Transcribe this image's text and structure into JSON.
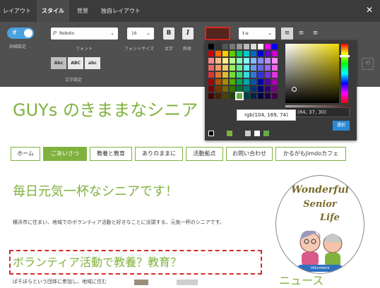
{
  "tabs": [
    "レイアウト",
    "スタイル",
    "背景",
    "独自レイアウト"
  ],
  "toolbar": {
    "toggle_label": "オ",
    "detail_label": "詳細設定",
    "font_value": "Roboto",
    "font_label": "フォント",
    "size_value": "16",
    "size_label": "フォントサイズ",
    "bold_label": "太字",
    "italic_label": "斜体",
    "bold_glyph": "B",
    "italic_glyph": "I",
    "case_buttons": [
      "Abc",
      "ABC",
      "abc"
    ],
    "case_label": "文字設定"
  },
  "picker": {
    "rgb_value": "(84, 37, 30)",
    "select_button": "選択",
    "tooltip": "rgb(104, 169, 74)"
  },
  "site": {
    "title": "GUYs のきままなシニア",
    "nav": [
      "ホーム",
      "ごあいさつ",
      "教養と教育",
      "ありのままに",
      "活動拠点",
      "お問い合わせ",
      "かるがもJimdoカフェ"
    ],
    "headline": "毎日元気一杯なシニアです！",
    "intro": "横浜市に住まい、地域でのボランティア活動と好きなことに没頭する、元気一杯のシニアです。",
    "h2": "ボランティア活動で教養？教育？",
    "para": "ぱそぼらという団体に参加し、地域に住む",
    "news_fragment": "ニュース",
    "logo_lines": [
      "Wonderful",
      "Senior",
      "Life"
    ],
    "logo_badge": "Volunteers"
  },
  "colors": {
    "accent": "#7fb23d",
    "editor_bg": "#505050",
    "selected": "#68a94a",
    "focus": "#d32b2b"
  }
}
